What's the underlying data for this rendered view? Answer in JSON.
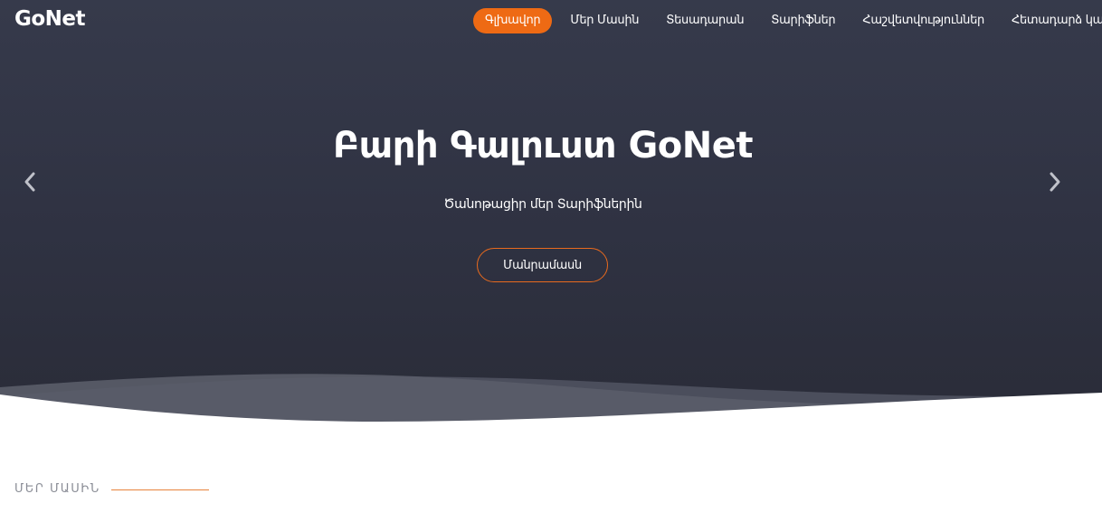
{
  "brand": {
    "logo": "GoNet",
    "accent_color": "#ee6a14"
  },
  "nav": {
    "items": [
      {
        "label": "Գլխավոր",
        "active": true
      },
      {
        "label": "Մեր Մասին",
        "active": false
      },
      {
        "label": "Տեսադարան",
        "active": false
      },
      {
        "label": "Տարիֆներ",
        "active": false
      },
      {
        "label": "Հաշվետվություններ",
        "active": false
      },
      {
        "label": "Հետադարձ կապ",
        "active": false
      }
    ]
  },
  "hero": {
    "title": "Բարի Գալուստ GoNet",
    "subtitle": "Ծանոթացիր մեր Տարիֆներին",
    "button_label": "Մանրամասն",
    "prev_icon": "chevron-left-icon",
    "next_icon": "chevron-right-icon"
  },
  "about": {
    "section_title": "ՄԵՐ ՄԱՍԻՆ"
  }
}
